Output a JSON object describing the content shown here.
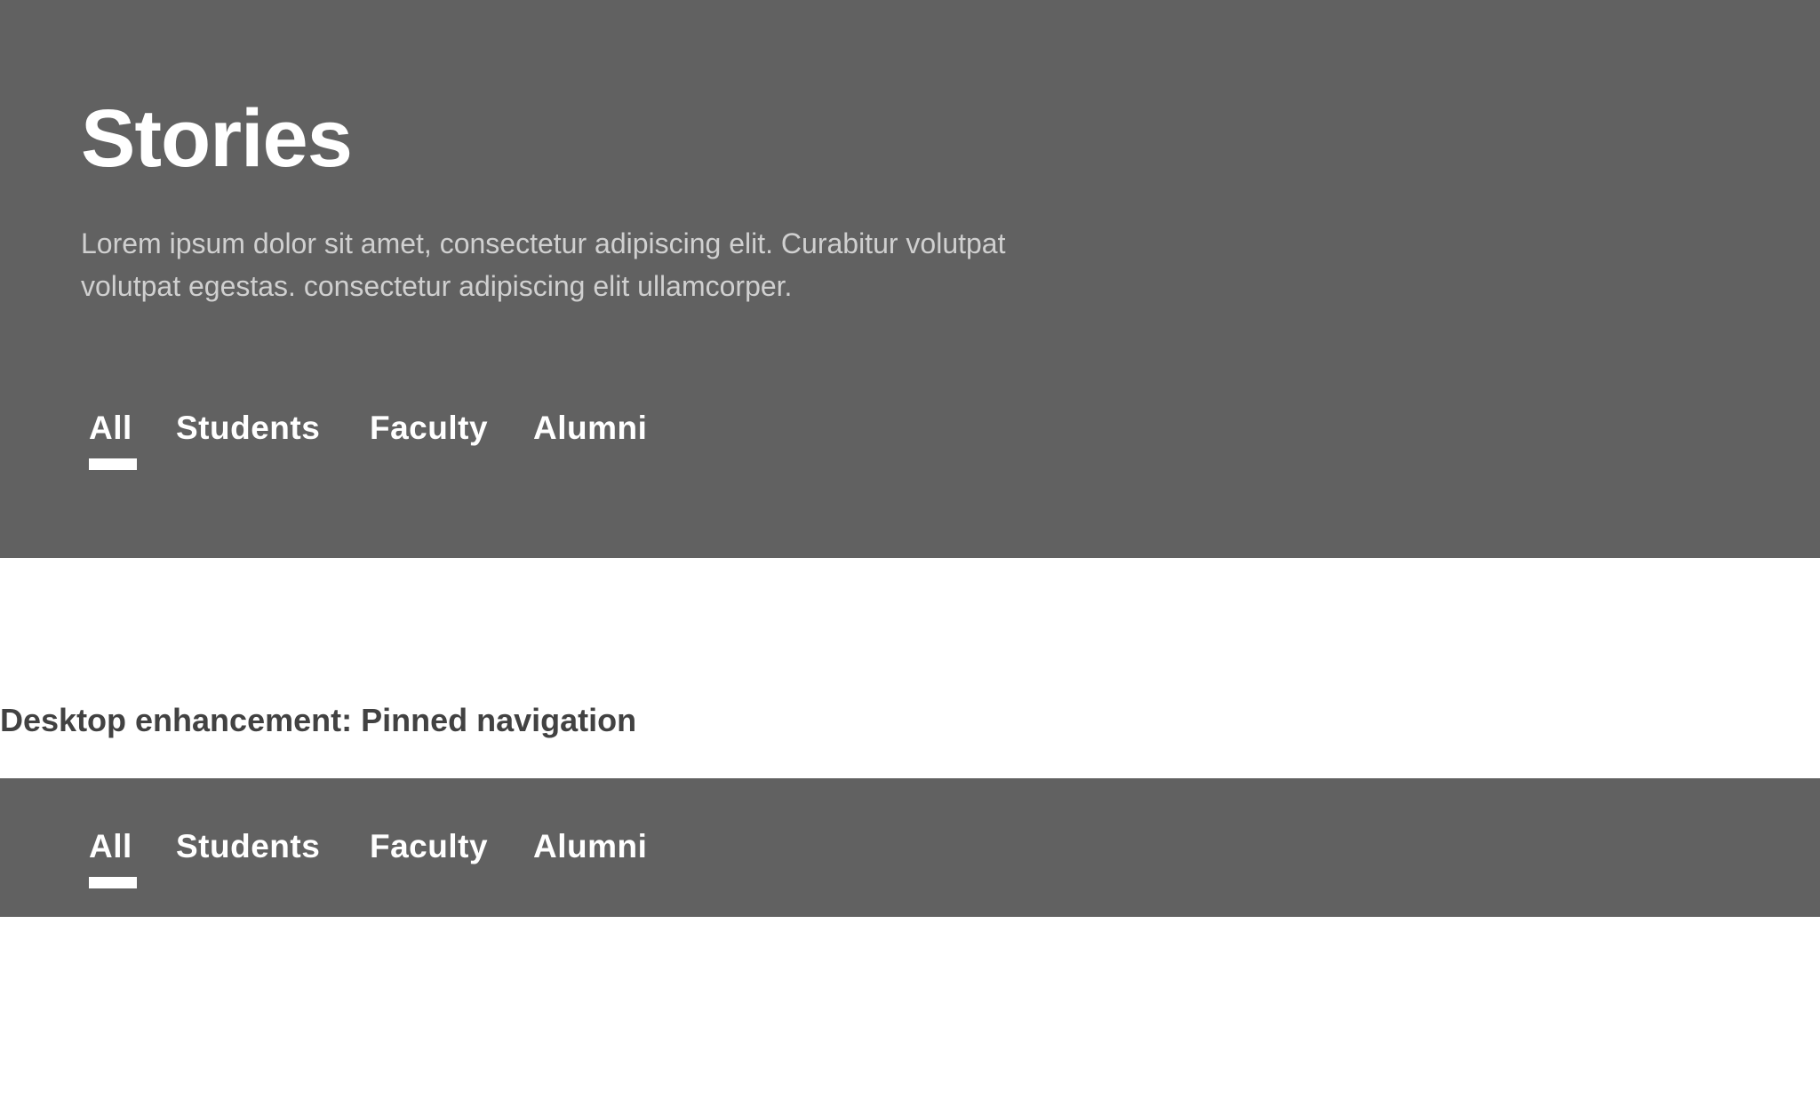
{
  "hero": {
    "title": "Stories",
    "description": "Lorem ipsum dolor sit amet, consectetur adipiscing elit. Curabitur volutpat volutpat egestas. consectetur adipiscing elit ullamcorper.",
    "tabs": [
      {
        "label": "All",
        "selected": true
      },
      {
        "label": "Students",
        "selected": false
      },
      {
        "label": "Faculty",
        "selected": false
      },
      {
        "label": "Alumni",
        "selected": false
      }
    ]
  },
  "section": {
    "heading": "Desktop enhancement: Pinned navigation"
  },
  "pinned_nav": {
    "tabs": [
      {
        "label": "All",
        "selected": true
      },
      {
        "label": "Students",
        "selected": false
      },
      {
        "label": "Faculty",
        "selected": false
      },
      {
        "label": "Alumni",
        "selected": false
      }
    ]
  },
  "colors": {
    "band_background": "#616161",
    "tab_text": "#ffffff",
    "description_text": "#d0d0d0",
    "heading_text": "#424242"
  }
}
